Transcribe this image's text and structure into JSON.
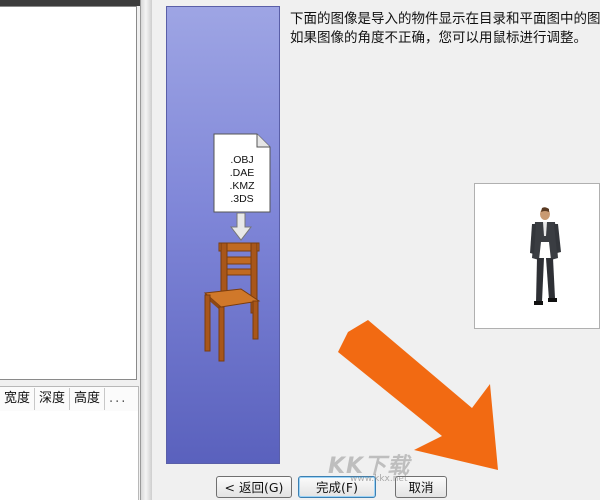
{
  "left_panel": {
    "columns": [
      "宽度",
      "深度",
      "高度",
      "..."
    ]
  },
  "banner": {
    "file_formats": [
      ".OBJ",
      ".DAE",
      ".KMZ",
      ".3DS"
    ]
  },
  "instruction": {
    "line1": "下面的图像是导入的物件显示在目录和平面图中的图",
    "line2": "如果图像的角度不正确，您可以用鼠标进行调整。"
  },
  "buttons": {
    "back_label": "< 返回(G)",
    "finish_label": "完成(F)",
    "cancel_label": "取消"
  },
  "watermark": {
    "text": "KK下载",
    "url": "www.kkx.net"
  },
  "colors": {
    "banner_top": "#9ea5e4",
    "banner_bottom": "#5a61bd",
    "arrow": "#f26a12",
    "chair_wood": "#b5651d"
  }
}
